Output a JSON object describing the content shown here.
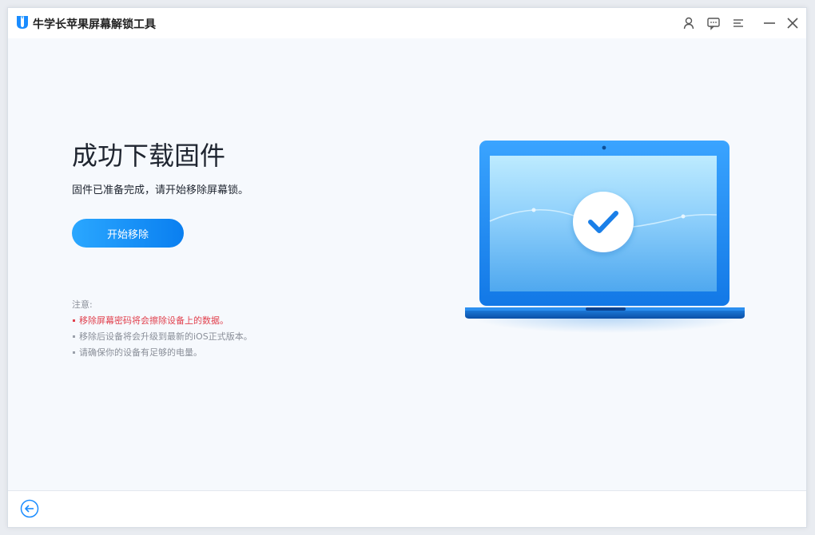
{
  "app": {
    "title": "牛学长苹果屏幕解锁工具",
    "brand_color": "#1a8cff"
  },
  "toolbar": {
    "icons": [
      "user-icon",
      "feedback-icon",
      "menu-icon",
      "minimize-icon",
      "close-icon"
    ]
  },
  "main": {
    "title": "成功下载固件",
    "subtitle": "固件已准备完成，请开始移除屏幕锁。",
    "start_button_label": "开始移除"
  },
  "notes": {
    "heading": "注意:",
    "items": [
      {
        "text": "移除屏幕密码将会擦除设备上的数据。",
        "color": "#e1414e"
      },
      {
        "text": "移除后设备将会升级到最新的iOS正式版本。",
        "color": "#8a8f99"
      },
      {
        "text": "请确保你的设备有足够的电量。",
        "color": "#8a8f99"
      }
    ]
  },
  "illustration": {
    "icon": "laptop-success-icon"
  },
  "footer": {
    "back_icon": "back-arrow-icon"
  }
}
